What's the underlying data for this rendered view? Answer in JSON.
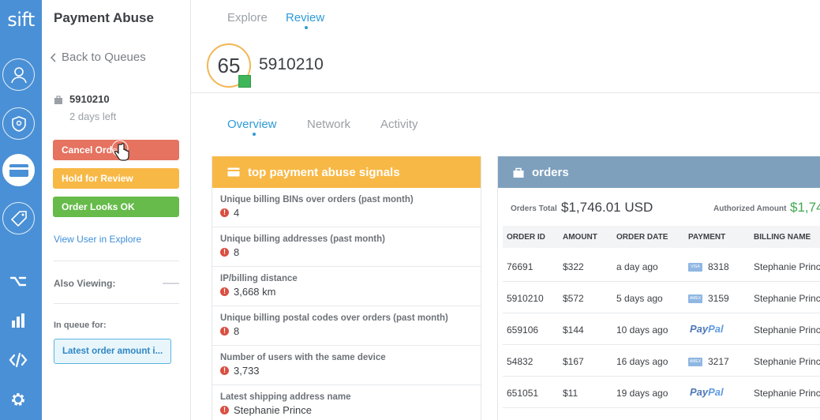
{
  "rail": {
    "logo": "sift",
    "icons": [
      "user-icon",
      "shield-icon",
      "credit-card-icon",
      "tag-icon",
      "workflow-icon",
      "bar-chart-icon",
      "code-icon",
      "gear-icon"
    ]
  },
  "sidebar": {
    "app_title": "Payment Abuse",
    "back_label": "Back to Queues",
    "order_id": "5910210",
    "days_left": "2 days left",
    "cancel_label": "Cancel Order",
    "hold_label": "Hold for Review",
    "ok_label": "Order Looks OK",
    "view_user_label": "View User in Explore",
    "also_viewing_label": "Also Viewing:",
    "in_queue_label": "In queue for:",
    "queue_chip": "Latest order amount i..."
  },
  "topnav": {
    "tabs": [
      {
        "label": "Explore",
        "active": false
      },
      {
        "label": "Review",
        "active": true
      }
    ]
  },
  "header": {
    "score": "65",
    "user_id": "5910210"
  },
  "content_tabs": [
    {
      "label": "Overview",
      "active": true
    },
    {
      "label": "Network",
      "active": false
    },
    {
      "label": "Activity",
      "active": false
    }
  ],
  "signals": {
    "title": "top payment abuse signals",
    "items": [
      {
        "label": "Unique billing BINs over orders (past month)",
        "value": "4"
      },
      {
        "label": "Unique billing addresses (past month)",
        "value": "8"
      },
      {
        "label": "IP/billing distance",
        "value": "3,668 km"
      },
      {
        "label": "Unique billing postal codes over orders (past month)",
        "value": "8"
      },
      {
        "label": "Number of users with the same device",
        "value": "3,733"
      },
      {
        "label": "Latest shipping address name",
        "value": "Stephanie Prince"
      }
    ]
  },
  "orders": {
    "title": "orders",
    "total_label": "Orders Total",
    "total_value": "$1,746.01 USD",
    "authorized_label": "Authorized Amount",
    "authorized_value": "$1,74",
    "columns": [
      "ORDER ID",
      "AMOUNT",
      "ORDER DATE",
      "PAYMENT",
      "BILLING NAME"
    ],
    "rows": [
      {
        "order_id": "76691",
        "amount": "$322",
        "date": "a day ago",
        "payment_type": "card",
        "card_brand": "VISA",
        "card_last4": "8318",
        "billing_name": "Stephanie Prince"
      },
      {
        "order_id": "5910210",
        "amount": "$572",
        "date": "5 days ago",
        "payment_type": "card",
        "card_brand": "AMEX",
        "card_last4": "3159",
        "billing_name": "Stephanie Prince"
      },
      {
        "order_id": "659106",
        "amount": "$144",
        "date": "10 days ago",
        "payment_type": "paypal",
        "paypal_a": "Pay",
        "paypal_b": "Pal",
        "billing_name": "Stephanie Prince"
      },
      {
        "order_id": "54832",
        "amount": "$167",
        "date": "16 days ago",
        "payment_type": "card",
        "card_brand": "AMEX",
        "card_last4": "3217",
        "billing_name": "Stephanie Prince"
      },
      {
        "order_id": "651051",
        "amount": "$11",
        "date": "19 days ago",
        "payment_type": "paypal",
        "paypal_a": "Pay",
        "paypal_b": "Pal",
        "billing_name": "Stephanie Prince"
      }
    ]
  },
  "colors": {
    "rail_blue": "#4a90d6",
    "cancel_red": "#e57360",
    "hold_orange": "#f8b846",
    "ok_green": "#66bb4a",
    "orders_header": "#7ea0bd",
    "accent_blue": "#2f9bd6"
  }
}
